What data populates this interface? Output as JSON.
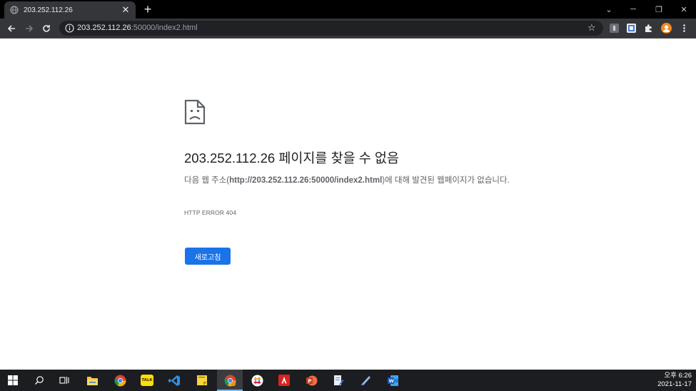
{
  "browser": {
    "tab": {
      "title": "203.252.112.26",
      "close": "✕",
      "favicon": "globe-icon"
    },
    "new_tab": "+",
    "window": {
      "dropdown": "⌄",
      "minimize": "─",
      "restore": "❐",
      "close": "✕"
    },
    "address": {
      "host": "203.252.112.26",
      "rest": ":50000/index2.html"
    },
    "extensions": [
      "bookmark-star-icon",
      "extension-1-icon",
      "extension-2-icon",
      "puzzle-icon",
      "profile-avatar-icon",
      "more-menu-icon"
    ]
  },
  "error_page": {
    "heading": "203.252.112.26 페이지를 찾을 수 없음",
    "desc_prefix": "다음 웹 주소(",
    "desc_url": "http://203.252.112.26:50000/index2.html",
    "desc_suffix": ")에 대해 발견된 웹페이지가 없습니다.",
    "error_code": "HTTP ERROR 404",
    "reload_label": "새로고침"
  },
  "taskbar": {
    "apps": [
      "windows-start-icon",
      "search-icon",
      "task-view-icon",
      "file-explorer-icon",
      "chrome-icon",
      "kakaotalk-icon",
      "vscode-icon",
      "sticky-notes-icon",
      "chrome-active-icon",
      "slack-icon",
      "acrobat-icon",
      "powerpoint-icon",
      "notepad-icon",
      "paint-icon",
      "word-icon"
    ],
    "kakao_label": "TALK",
    "clock_time": "오후 6:26",
    "clock_date": "2021-11-17"
  },
  "colors": {
    "accent": "#1a73e8",
    "toolbar": "#35363a",
    "tabstrip": "#000000",
    "taskbar": "#1c1d20"
  }
}
